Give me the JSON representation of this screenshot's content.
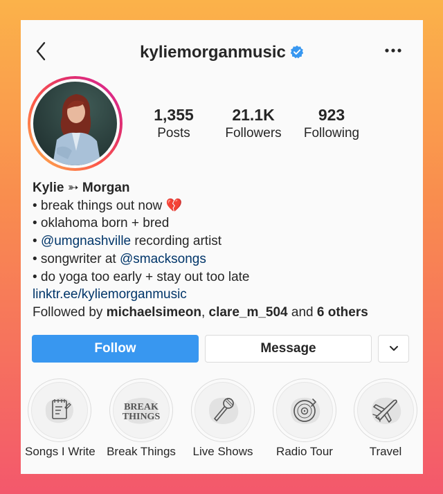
{
  "profile": {
    "username": "kyliemorganmusic",
    "verified": true,
    "display_name": "Kylie ➳ Morgan",
    "avatar_icon": "profile-photo",
    "accent_color": "#3897f0",
    "link_color": "#003569"
  },
  "stats": {
    "posts": {
      "value": "1,355",
      "label": "Posts"
    },
    "followers": {
      "value": "21.1K",
      "label": "Followers"
    },
    "following": {
      "value": "923",
      "label": "Following"
    }
  },
  "bio": {
    "line1": "• break things out now 💔",
    "line2": "• oklahoma born + bred",
    "line3_bullet": "• ",
    "line3_mention": "@umgnashville",
    "line3_rest": " recording artist",
    "line4_text": "• songwriter at ",
    "line4_mention": "@smacksongs",
    "line5": "• do yoga too early + stay out too late",
    "website": "linktr.ee/kyliemorganmusic",
    "followed_by_prefix": "Followed by ",
    "followed_by_user1": "michaelsimeon",
    "followed_by_sep": ", ",
    "followed_by_user2": "clare_m_504",
    "followed_by_and": " and ",
    "followed_by_others": "6 others"
  },
  "actions": {
    "follow_label": "Follow",
    "message_label": "Message",
    "dropdown_icon": "chevron-down-icon"
  },
  "highlights": [
    {
      "label": "Songs I Write",
      "icon": "notepad-icon"
    },
    {
      "label": "Break Things",
      "icon": "break-things-text",
      "text_line1": "BREAK",
      "text_line2": "THINGS"
    },
    {
      "label": "Live Shows",
      "icon": "microphone-icon"
    },
    {
      "label": "Radio Tour",
      "icon": "vinyl-record-icon"
    },
    {
      "label": "Travel",
      "icon": "airplane-icon"
    }
  ]
}
